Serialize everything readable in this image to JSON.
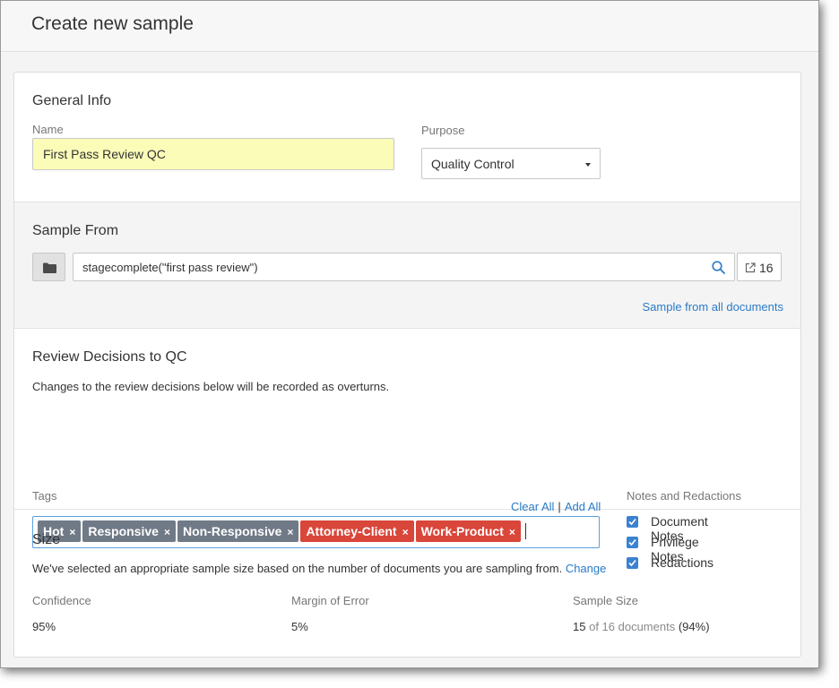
{
  "dialog": {
    "title": "Create new sample"
  },
  "general": {
    "title": "General Info",
    "name_label": "Name",
    "name_value": "First Pass Review QC",
    "purpose_label": "Purpose",
    "purpose_value": "Quality Control"
  },
  "sample_from": {
    "title": "Sample From",
    "query": "stagecomplete(\"first pass review\")",
    "count": "16",
    "all_docs_link": "Sample from all documents"
  },
  "review": {
    "title": "Review Decisions to QC",
    "description": "Changes to the review decisions below will be recorded as overturns.",
    "tags_label": "Tags",
    "clear_all": "Clear All",
    "separator": "|",
    "add_all": "Add All",
    "tags": [
      {
        "label": "Hot",
        "color": "gray"
      },
      {
        "label": "Responsive",
        "color": "gray"
      },
      {
        "label": "Non-Responsive",
        "color": "gray"
      },
      {
        "label": "Attorney-Client",
        "color": "red"
      },
      {
        "label": "Work-Product",
        "color": "red"
      }
    ],
    "tag_remove": "×",
    "notes_label": "Notes and Redactions",
    "checkboxes": [
      {
        "label": "Document Notes",
        "checked": true
      },
      {
        "label": "Privilege Notes",
        "checked": true
      },
      {
        "label": "Redactions",
        "checked": true
      }
    ]
  },
  "size": {
    "title": "Size",
    "description": "We've selected an appropriate sample size based on the number of documents you are sampling from.",
    "change_link": "Change",
    "confidence_label": "Confidence",
    "confidence_value": "95%",
    "margin_label": "Margin of Error",
    "margin_value": "5%",
    "sample_size_label": "Sample Size",
    "sample_count": "15",
    "sample_of": "of 16 documents",
    "sample_pct": "(94%)"
  },
  "colors": {
    "accent": "#2a7bc8",
    "tag_gray": "#707a87",
    "tag_red": "#d9463a",
    "name_highlight": "#fafcb8"
  }
}
